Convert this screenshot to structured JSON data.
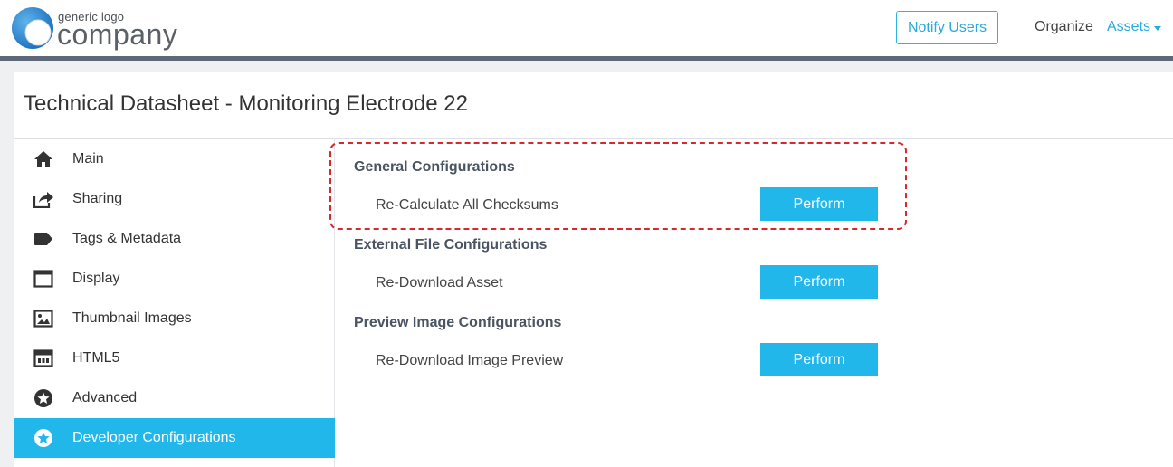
{
  "header": {
    "logo_small": "generic logo",
    "logo_big": "company",
    "notify_label": "Notify Users",
    "organize_label": "Organize",
    "assets_label": "Assets"
  },
  "page": {
    "title": "Technical Datasheet - Monitoring Electrode 22"
  },
  "sidebar": {
    "items": [
      {
        "label": "Main",
        "icon": "home-icon"
      },
      {
        "label": "Sharing",
        "icon": "share-icon"
      },
      {
        "label": "Tags & Metadata",
        "icon": "tag-icon"
      },
      {
        "label": "Display",
        "icon": "window-icon"
      },
      {
        "label": "Thumbnail Images",
        "icon": "image-icon"
      },
      {
        "label": "HTML5",
        "icon": "html5-icon"
      },
      {
        "label": "Advanced",
        "icon": "star-circle-icon"
      },
      {
        "label": "Developer Configurations",
        "icon": "star-circle-icon",
        "active": true
      }
    ]
  },
  "sections": [
    {
      "title": "General Configurations",
      "action": "Re-Calculate All Checksums",
      "button": "Perform"
    },
    {
      "title": "External File Configurations",
      "action": "Re-Download Asset",
      "button": "Perform"
    },
    {
      "title": "Preview Image Configurations",
      "action": "Re-Download Image Preview",
      "button": "Perform"
    }
  ],
  "colors": {
    "accent": "#22b7ea",
    "header_bar": "#5d6878",
    "highlight": "#d9272e"
  }
}
